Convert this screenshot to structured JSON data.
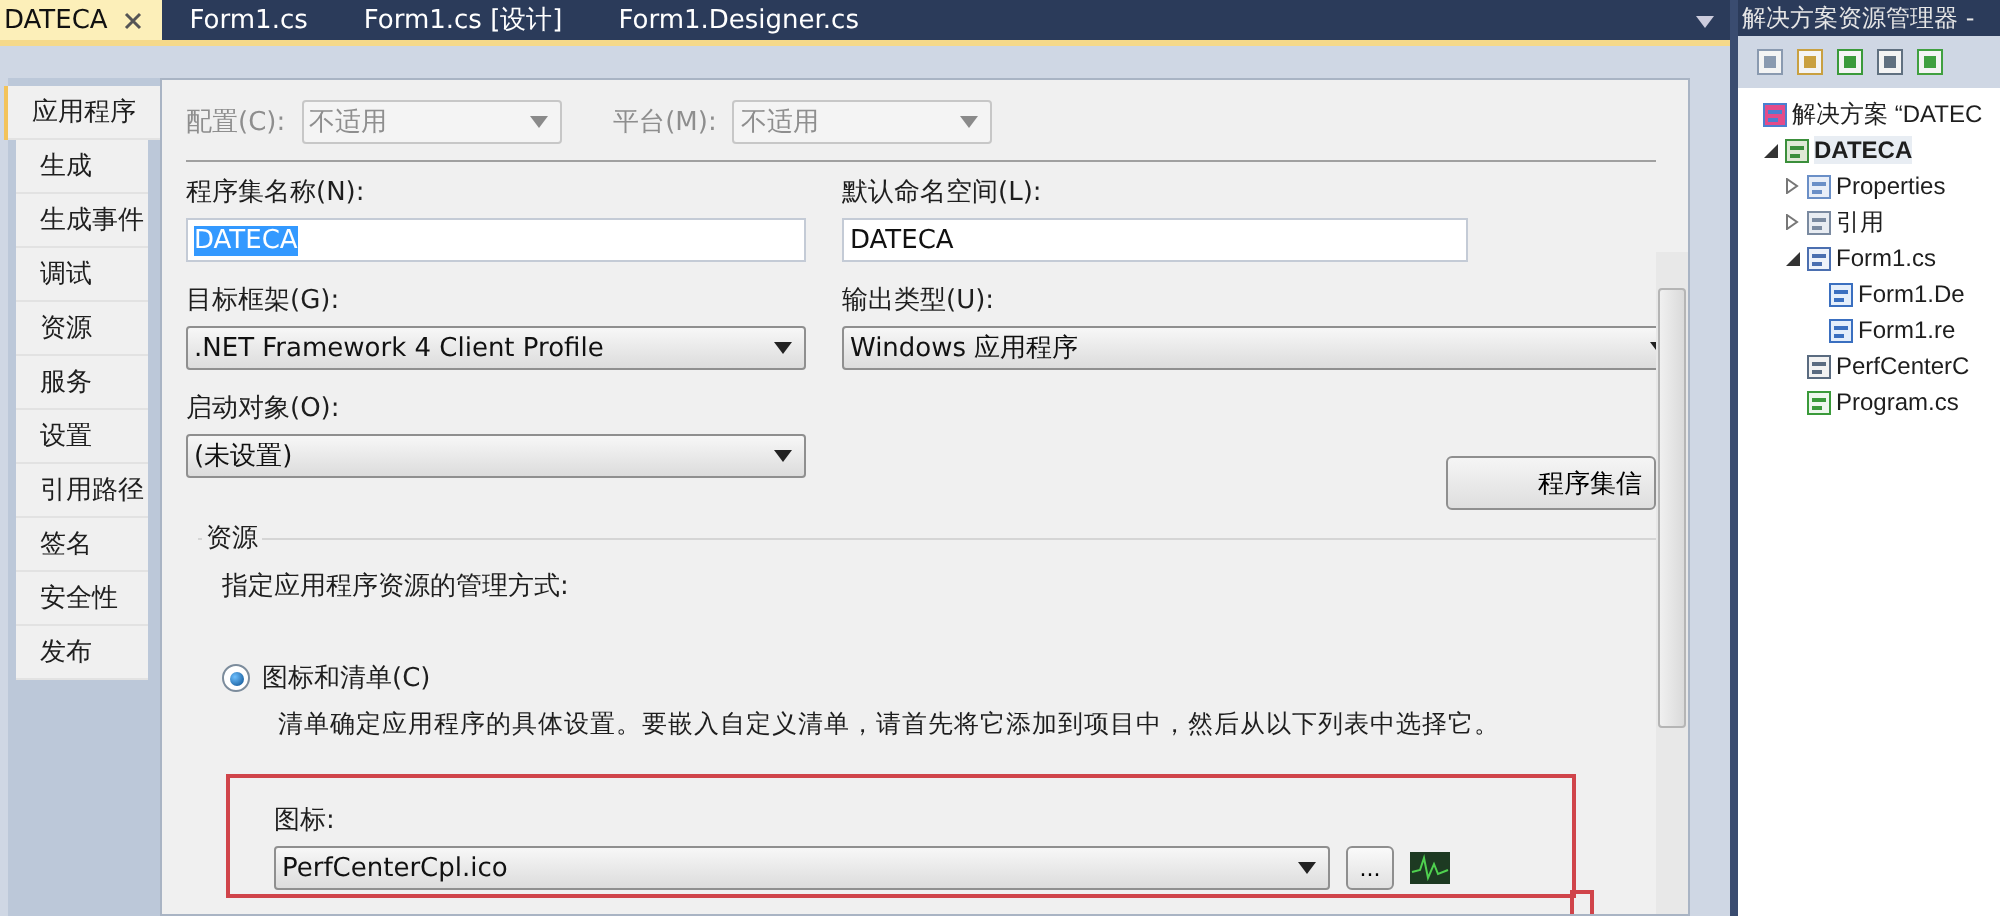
{
  "editor_tabs": [
    {
      "label": "DATECA",
      "selected": true,
      "closable": true
    },
    {
      "label": "Form1.cs",
      "selected": false,
      "closable": false
    },
    {
      "label": "Form1.cs [设计]",
      "selected": false,
      "closable": false
    },
    {
      "label": "Form1.Designer.cs",
      "selected": false,
      "closable": false
    }
  ],
  "property_pages": [
    {
      "label": "应用程序",
      "selected": true
    },
    {
      "label": "生成",
      "selected": false
    },
    {
      "label": "生成事件",
      "selected": false
    },
    {
      "label": "调试",
      "selected": false
    },
    {
      "label": "资源",
      "selected": false
    },
    {
      "label": "服务",
      "selected": false
    },
    {
      "label": "设置",
      "selected": false
    },
    {
      "label": "引用路径",
      "selected": false
    },
    {
      "label": "签名",
      "selected": false
    },
    {
      "label": "安全性",
      "selected": false
    },
    {
      "label": "发布",
      "selected": false
    }
  ],
  "configuration": {
    "label": "配置(C):",
    "value": "不适用",
    "disabled": true
  },
  "platform": {
    "label": "平台(M):",
    "value": "不适用",
    "disabled": true
  },
  "assembly_name": {
    "label": "程序集名称(N):",
    "value": "DATECA",
    "text_selected": true
  },
  "default_namespace": {
    "label": "默认命名空间(L):",
    "value": "DATECA",
    "text_selected": false
  },
  "target_framework": {
    "label": "目标框架(G):",
    "value": ".NET Framework 4 Client Profile"
  },
  "output_type": {
    "label": "输出类型(U):",
    "value": "Windows 应用程序"
  },
  "startup_object": {
    "label": "启动对象(O):",
    "value": "(未设置)"
  },
  "assembly_info_button": "程序集信",
  "resources": {
    "title": "资源",
    "description": "指定应用程序资源的管理方式:",
    "options": [
      {
        "label": "图标和清单(C)",
        "selected": true,
        "description": "清单确定应用程序的具体设置。要嵌入自定义清单，请首先将它添加到项目中，然后从以下列表中选择它。"
      }
    ],
    "icon_label": "图标:",
    "icon_value": "PerfCenterCpl.ico",
    "browse_button": "..."
  },
  "solution_explorer": {
    "title": "解决方案资源管理器 -",
    "tree": [
      {
        "label": "解决方案 “DATEC",
        "kind": "solution",
        "bold": false,
        "children": [
          {
            "label": "DATECA",
            "kind": "project",
            "expanded": true,
            "bold": true,
            "children": [
              {
                "label": "Properties",
                "kind": "properties",
                "expanded": false,
                "bold": false
              },
              {
                "label": "引用",
                "kind": "references",
                "expanded": false,
                "bold": false
              },
              {
                "label": "Form1.cs",
                "kind": "form",
                "expanded": true,
                "bold": false,
                "children": [
                  {
                    "label": "Form1.De",
                    "kind": "code",
                    "bold": false
                  },
                  {
                    "label": "Form1.re",
                    "kind": "code",
                    "bold": false
                  }
                ]
              },
              {
                "label": "PerfCenterC",
                "kind": "resource",
                "bold": false
              },
              {
                "label": "Program.cs",
                "kind": "program",
                "bold": false
              }
            ]
          }
        ]
      }
    ]
  }
}
